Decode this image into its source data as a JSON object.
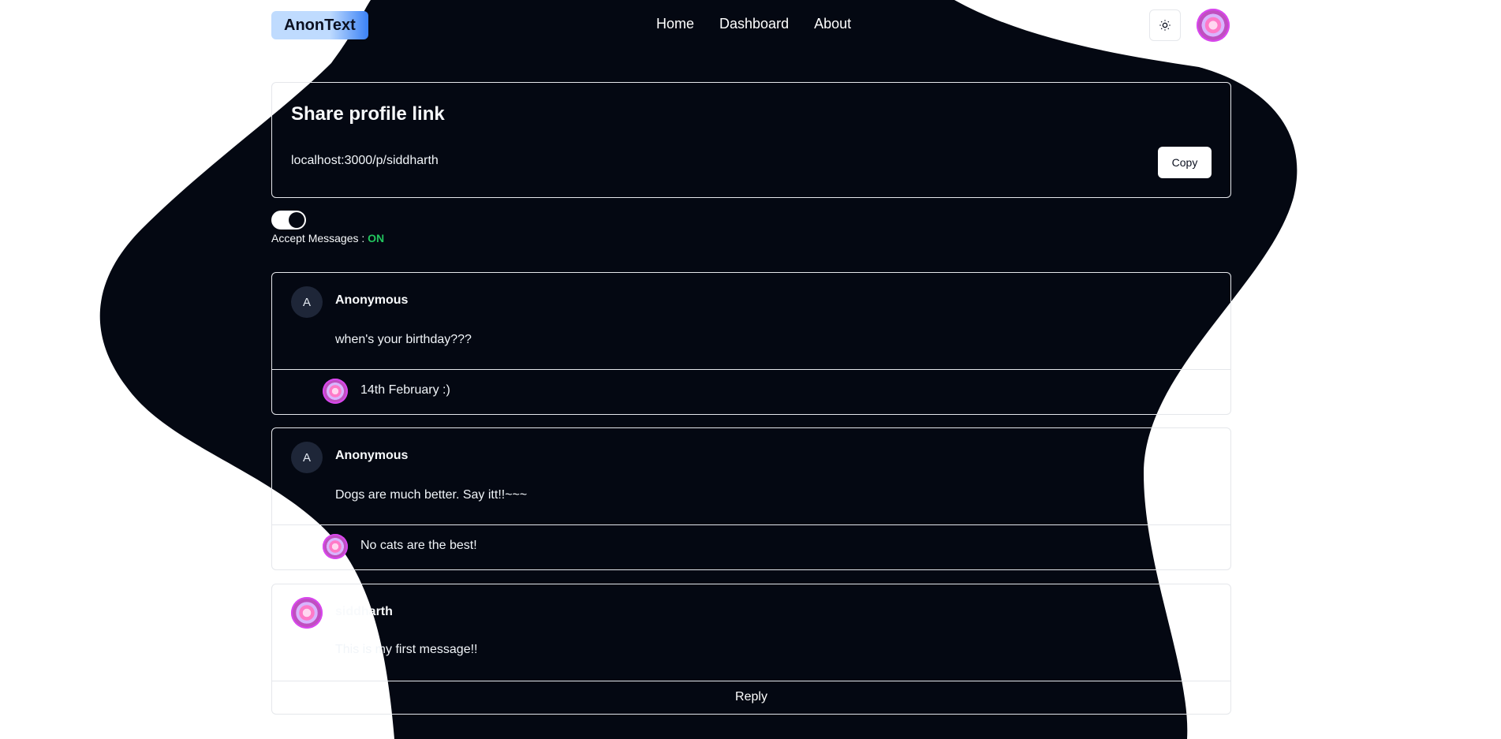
{
  "app": {
    "logo": "AnonText"
  },
  "nav": {
    "items": [
      "Home",
      "Dashboard",
      "About"
    ]
  },
  "share": {
    "title": "Share profile link",
    "url": "localhost:3000/p/siddharth",
    "copy_label": "Copy"
  },
  "accept": {
    "label": "Accept Messages : ",
    "status": "ON"
  },
  "messages": [
    {
      "avatar_letter": "A",
      "author": "Anonymous",
      "text": "when's your birthday???",
      "reply": "14th February :)"
    },
    {
      "avatar_letter": "A",
      "author": "Anonymous",
      "text": "Dogs are much better. Say itt!!~~~",
      "reply": "No cats are the best!"
    },
    {
      "author": "siddharth",
      "text": "This is my first message!!",
      "reply_label": "Reply"
    }
  ],
  "colors": {
    "blob": "#040812",
    "accent_on": "#22c55e",
    "logo_start": "#bfdbfe",
    "logo_end": "#3b82f6"
  },
  "icons": {
    "theme": "sun-icon",
    "avatar": "donut-avatar"
  }
}
